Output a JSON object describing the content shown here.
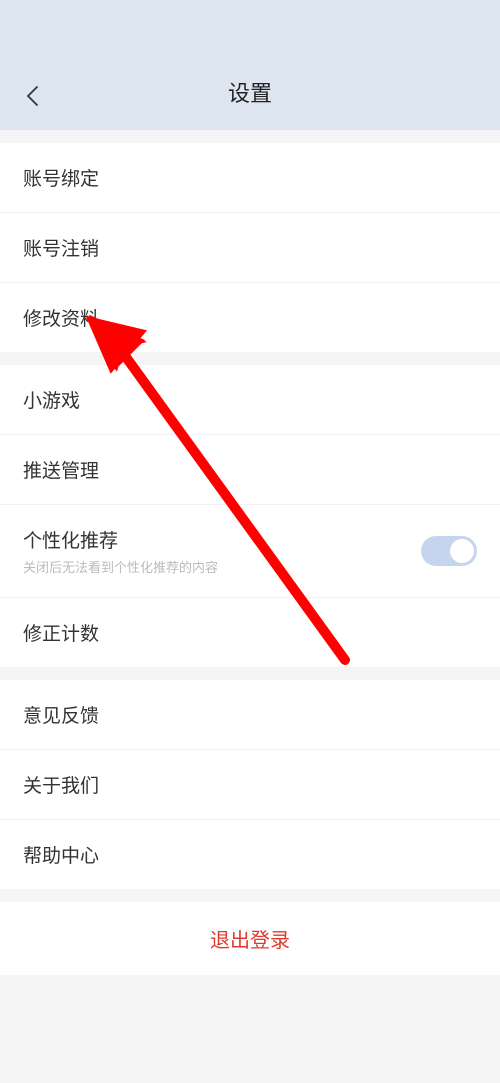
{
  "header": {
    "title": "设置"
  },
  "sections": [
    {
      "items": [
        {
          "label": "账号绑定"
        },
        {
          "label": "账号注销"
        },
        {
          "label": "修改资料"
        }
      ]
    },
    {
      "items": [
        {
          "label": "小游戏"
        },
        {
          "label": "推送管理"
        },
        {
          "label": "个性化推荐",
          "sublabel": "关闭后无法看到个性化推荐的内容",
          "toggle": true
        },
        {
          "label": "修正计数"
        }
      ]
    },
    {
      "items": [
        {
          "label": "意见反馈"
        },
        {
          "label": "关于我们"
        },
        {
          "label": "帮助中心"
        }
      ]
    }
  ],
  "logout": {
    "label": "退出登录"
  }
}
